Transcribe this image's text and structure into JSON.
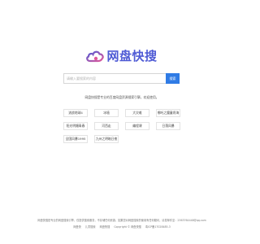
{
  "brand": {
    "name": "网盘快搜",
    "accent": "#4f5bd5",
    "icon": "cloud-logo-icon"
  },
  "search": {
    "placeholder": "请输入要搜索的内容",
    "button_label": "搜索",
    "button_color": "#2f7be5"
  },
  "tagline": "网盘快搜是专业的百度网盘资源搜索引擎，欢迎使用。",
  "hot_tags": [
    "流浪地球4",
    "冰墙",
    "大灾难",
    "哪吒之魔童闹海",
    "阳光明媚青春",
    "河西走",
    "编程课",
    "日落风暴",
    "全国风暴1995",
    "九州之明暗日夜"
  ],
  "footer": {
    "disclaimer": "网盘快搜是专业的网盘搜索引擎，仅提供搜索服务，不存储任何资源。如果您对网盘搜索的使用有任何疑问，请发邮件至：2363764448@qq.com",
    "links": [
      "网盘快",
      "儿童搜索",
      "网盘快搜",
      "Copyright © 网盘快搜",
      "粤ICP备17028485-3"
    ]
  }
}
